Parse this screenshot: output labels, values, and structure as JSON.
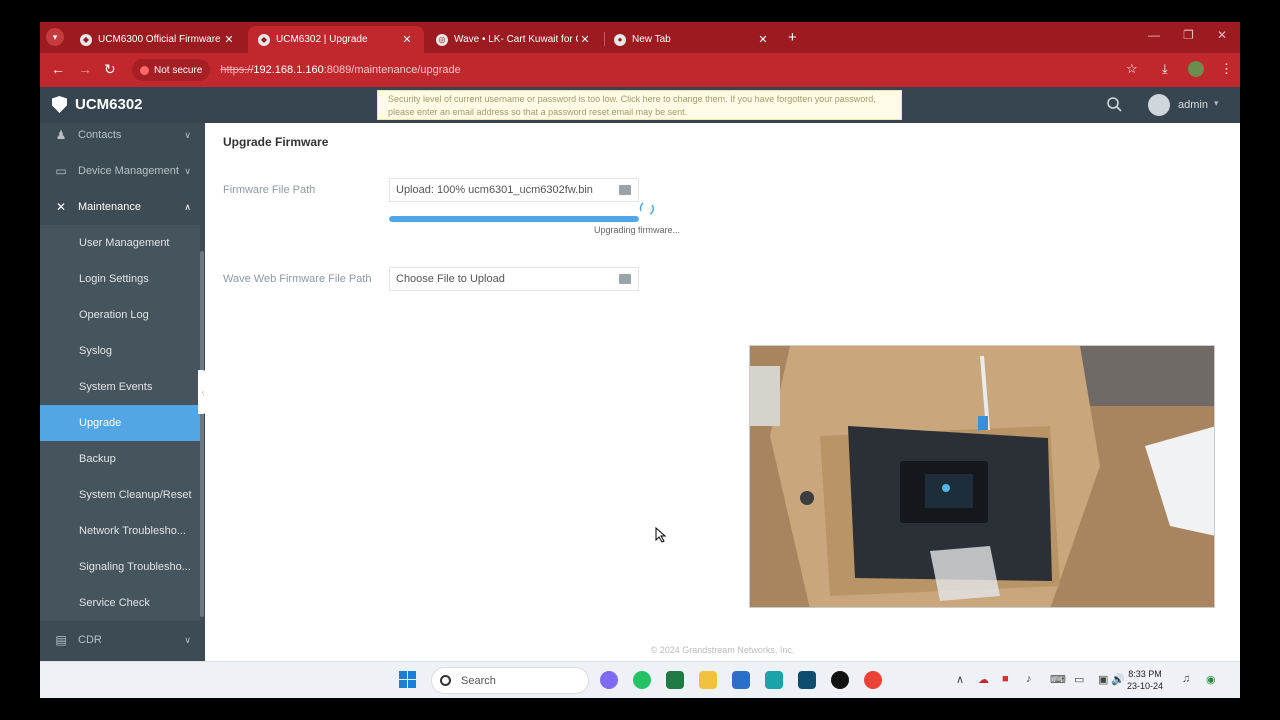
{
  "browser": {
    "tabs": [
      {
        "label": "UCM6300 Official Firmware"
      },
      {
        "label": "UCM6302 | Upgrade"
      },
      {
        "label": "Wave • LK- Cart Kuwait for Com"
      },
      {
        "label": "New Tab"
      }
    ],
    "security_chip": "Not secure",
    "url_scheme": "https://",
    "url_host": "192.168.1.160",
    "url_path": ":8089/maintenance/upgrade",
    "colors": {
      "frame": "#c0282d",
      "tabstrip": "#9b1b20"
    }
  },
  "app": {
    "logo_text": "UCM6302",
    "notice": "Security level of current username or password is too low. Click here to change them. If you have forgotten your password, please enter an email address so that a password reset email may be sent.",
    "user": "admin"
  },
  "sidebar": {
    "sections": [
      {
        "label": "Contacts",
        "icon": "user-icon"
      },
      {
        "label": "Device Management",
        "icon": "device-icon"
      },
      {
        "label": "Maintenance",
        "icon": "tools-icon"
      },
      {
        "label": "CDR",
        "icon": "document-icon"
      }
    ],
    "sub_items": [
      {
        "label": "User Management"
      },
      {
        "label": "Login Settings"
      },
      {
        "label": "Operation Log"
      },
      {
        "label": "Syslog"
      },
      {
        "label": "System Events"
      },
      {
        "label": "Upgrade"
      },
      {
        "label": "Backup"
      },
      {
        "label": "System Cleanup/Reset"
      },
      {
        "label": "Network Troublesho..."
      },
      {
        "label": "Signaling Troublesho..."
      },
      {
        "label": "Service Check"
      }
    ],
    "colors": {
      "bg": "#3d4b55",
      "active": "#53a6e6"
    }
  },
  "main": {
    "title": "Upgrade Firmware",
    "firmware_label": "Firmware File Path",
    "firmware_value": "Upload: 100% ucm6301_ucm6302fw.bin",
    "progress_percent": 100,
    "progress_status": "Upgrading firmware...",
    "wave_label": "Wave Web Firmware File Path",
    "wave_value": "Choose File to Upload",
    "footer": "© 2024 Grandstream Networks, Inc."
  },
  "taskbar": {
    "search_placeholder": "Search",
    "time": "8:33 PM",
    "date": "23-10-24"
  }
}
